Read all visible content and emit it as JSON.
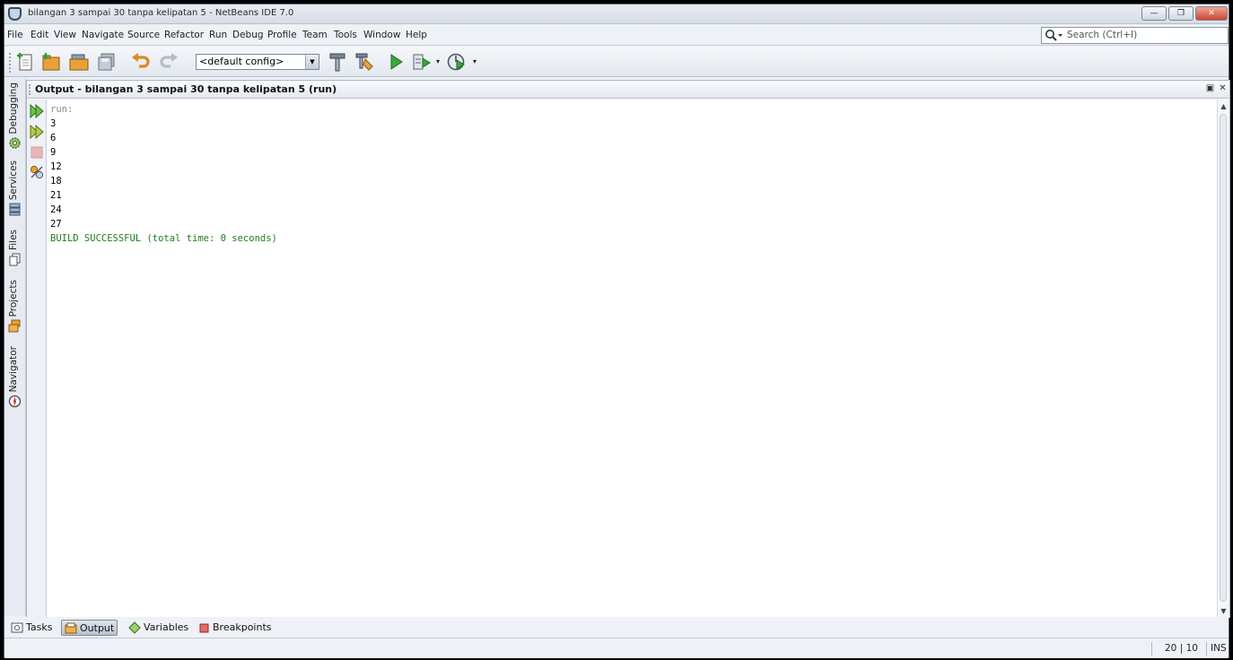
{
  "window": {
    "title": "bilangan 3 sampai 30 tanpa kelipatan 5 - NetBeans IDE 7.0",
    "minimize_label": "—",
    "maximize_label": "❐",
    "close_label": "✕"
  },
  "menu": {
    "items": [
      "File",
      "Edit",
      "View",
      "Navigate",
      "Source",
      "Refactor",
      "Run",
      "Debug",
      "Profile",
      "Team",
      "Tools",
      "Window",
      "Help"
    ]
  },
  "search": {
    "placeholder": "Search (Ctrl+I)"
  },
  "toolbar": {
    "config_value": "<default config>",
    "dropdown_arrow": "▾"
  },
  "left_tabs": [
    "Debugging",
    "Services",
    "Files",
    "Projects",
    "Navigator"
  ],
  "output_panel": {
    "title": "Output - bilangan 3 sampai 30 tanpa kelipatan 5 (run)",
    "maximize_label": "▣",
    "close_label": "✕",
    "lines": [
      "run:",
      "3",
      "6",
      "9",
      "12",
      "18",
      "21",
      "24",
      "27",
      "BUILD SUCCESSFUL (total time: 0 seconds)"
    ],
    "colors": {
      "muted": "#8a8a8a",
      "normal": "#000000",
      "success": "#1f7d1f"
    }
  },
  "bottom_tabs": {
    "tasks": "Tasks",
    "output": "Output",
    "variables": "Variables",
    "breakpoints": "Breakpoints",
    "active": "Output"
  },
  "status": {
    "position": "20 | 10",
    "mode": "INS"
  }
}
